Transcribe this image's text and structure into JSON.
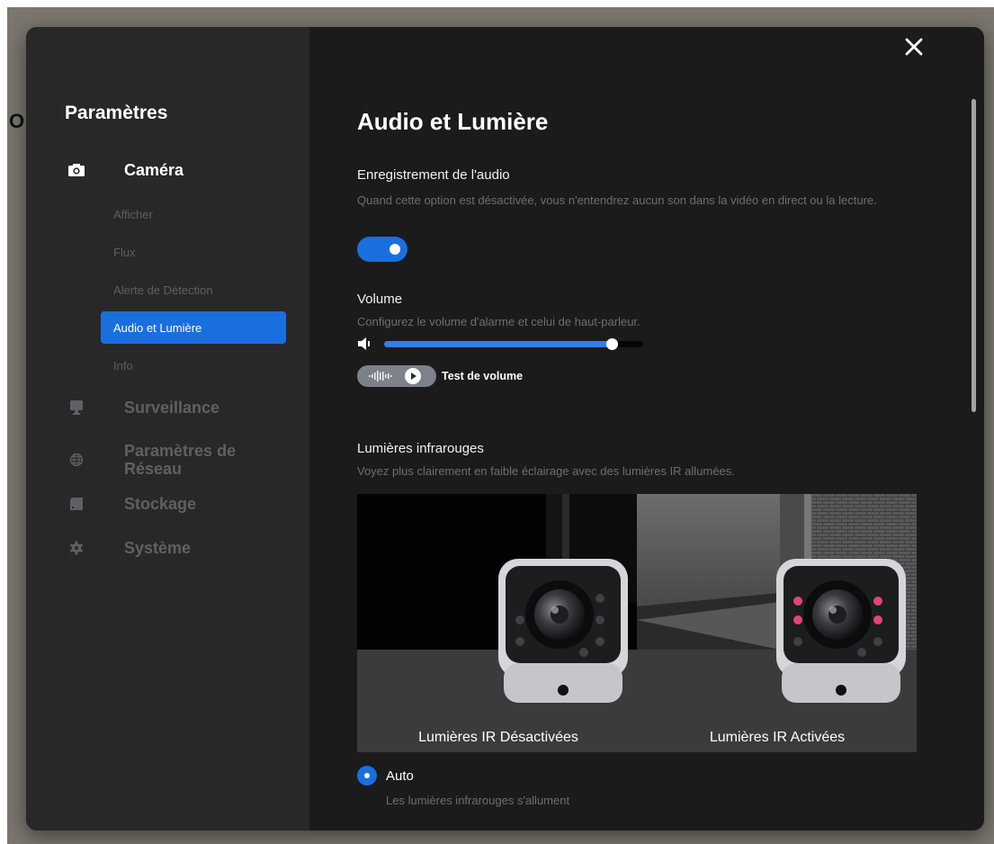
{
  "backdrop": {
    "glyph": "O"
  },
  "sidebar": {
    "title": "Paramètres",
    "camera": {
      "label": "Caméra",
      "icon": "camera-icon"
    },
    "sub_items": [
      "Afficher",
      "Flux",
      "Alerte de Détection",
      "Audio et Lumière",
      "Info"
    ],
    "selected_sub_item": "Audio et Lumière",
    "surveillance": {
      "label": "Surveillance",
      "icon": "monitor-icon"
    },
    "reseau": {
      "label_line1": "Paramètres de",
      "label_line2": "Réseau",
      "icon": "globe-icon"
    },
    "stockage": {
      "label": "Stockage",
      "icon": "storage-icon"
    },
    "systeme": {
      "label": "Système",
      "icon": "gear-icon"
    }
  },
  "main": {
    "title": "Audio et Lumière",
    "audio_recording": {
      "title": "Enregistrement de l'audio",
      "desc": "Quand cette option est désactivée, vous n'entendrez aucun son dans la vidéo en direct ou la lecture.",
      "enabled": true
    },
    "volume": {
      "title": "Volume",
      "desc": "Configurez le volume d'alarme et celui de haut-parleur.",
      "level_percent": 88,
      "test_label": "Test de volume"
    },
    "ir_lights": {
      "title": "Lumières infrarouges",
      "desc": "Voyez plus clairement en faible éclairage avec des lumières IR allumées.",
      "off_label": "Lumières IR Désactivées",
      "on_label": "Lumières IR Activées",
      "ir_led_color": "#e0457b"
    },
    "ir_mode": {
      "selected_label": "Auto",
      "selected_desc": "Les lumières infrarouges s'allument"
    }
  },
  "colors": {
    "accent": "#1a6fdf",
    "sidebar_bg": "#282829",
    "main_bg": "#1b1b1c",
    "muted_text": "#6d6e71"
  }
}
